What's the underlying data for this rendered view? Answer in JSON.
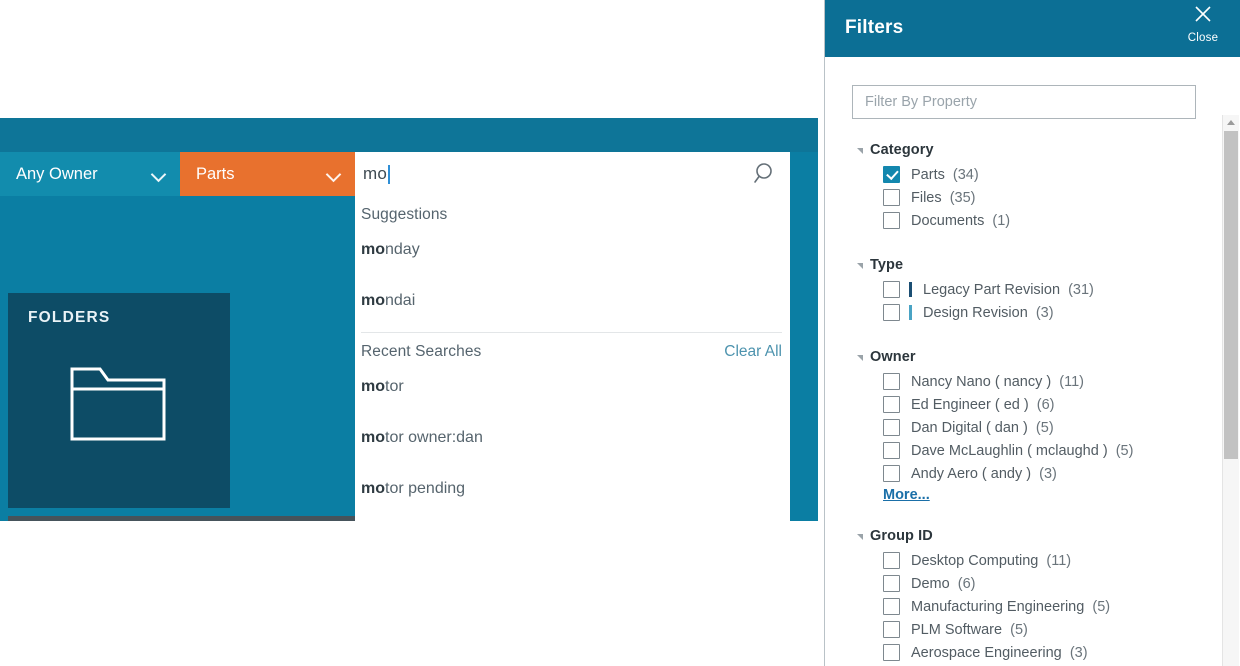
{
  "search": {
    "owner_filter_label": "Any Owner",
    "category_filter_label": "Parts",
    "query_value": "mo",
    "search_icon": "magnifier-icon",
    "dropdown": {
      "suggestions_heading": "Suggestions",
      "suggestions": [
        {
          "match": "mo",
          "rest": "nday"
        },
        {
          "match": "mo",
          "rest": "ndai"
        }
      ],
      "recent_heading": "Recent Searches",
      "clear_all_label": "Clear All",
      "recent": [
        {
          "match": "mo",
          "rest": "tor"
        },
        {
          "match": "mo",
          "rest": "tor owner:dan"
        },
        {
          "match": "mo",
          "rest": "tor pending"
        }
      ]
    }
  },
  "tile": {
    "label": "FOLDERS",
    "icon": "folder-icon"
  },
  "filters": {
    "title": "Filters",
    "close_label": "Close",
    "close_icon": "close-x-icon",
    "property_filter_placeholder": "Filter By Property",
    "more_label": "More...",
    "sections": [
      {
        "title": "Category",
        "options": [
          {
            "label": "Parts",
            "count": "(34)",
            "checked": true
          },
          {
            "label": "Files",
            "count": "(35)",
            "checked": false
          },
          {
            "label": "Documents",
            "count": "(1)",
            "checked": false
          }
        ]
      },
      {
        "title": "Type",
        "options": [
          {
            "label": "Legacy Part Revision",
            "count": "(31)",
            "checked": false,
            "color": "#1b4e73"
          },
          {
            "label": "Design Revision",
            "count": "(3)",
            "checked": false,
            "color": "#4aa3c4"
          }
        ]
      },
      {
        "title": "Owner",
        "options": [
          {
            "label": "Nancy Nano ( nancy )",
            "count": "(11)",
            "checked": false
          },
          {
            "label": "Ed Engineer ( ed )",
            "count": "(6)",
            "checked": false
          },
          {
            "label": "Dan Digital ( dan )",
            "count": "(5)",
            "checked": false
          },
          {
            "label": "Dave McLaughlin ( mclaughd )",
            "count": "(5)",
            "checked": false
          },
          {
            "label": "Andy Aero ( andy )",
            "count": "(3)",
            "checked": false
          }
        ],
        "has_more": true
      },
      {
        "title": "Group ID",
        "options": [
          {
            "label": "Desktop Computing",
            "count": "(11)",
            "checked": false
          },
          {
            "label": "Demo",
            "count": "(6)",
            "checked": false
          },
          {
            "label": "Manufacturing Engineering",
            "count": "(5)",
            "checked": false
          },
          {
            "label": "PLM Software",
            "count": "(5)",
            "checked": false
          },
          {
            "label": "Aerospace Engineering",
            "count": "(3)",
            "checked": false
          }
        ]
      }
    ]
  },
  "colors": {
    "panel_blue": "#0b7ea3",
    "header_blue": "#0c6f95",
    "accent_orange": "#e8712e",
    "tile_navy": "#0d4c66",
    "checkbox_checked": "#1387ae",
    "link_blue": "#1a6fa8",
    "clear_all_link": "#4d93ae"
  }
}
